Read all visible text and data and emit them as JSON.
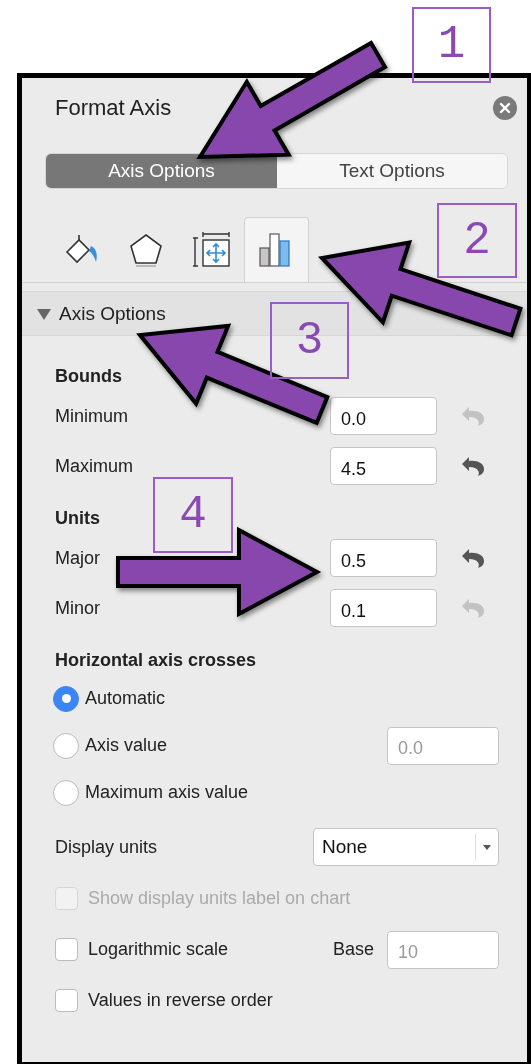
{
  "panel": {
    "title": "Format Axis"
  },
  "option_tabs": [
    {
      "label": "Axis Options",
      "selected": true
    },
    {
      "label": "Text Options",
      "selected": false
    }
  ],
  "icon_tabs": [
    {
      "kind": "fill",
      "selected": false
    },
    {
      "kind": "effects",
      "selected": false
    },
    {
      "kind": "size",
      "selected": false
    },
    {
      "kind": "axis",
      "selected": true
    }
  ],
  "section": {
    "title": "Axis Options",
    "expanded": true
  },
  "fields": [
    {
      "kind": "heading",
      "label": "Bounds"
    },
    {
      "kind": "number",
      "label": "Minimum",
      "value": "0.0",
      "reset_enabled": false
    },
    {
      "kind": "number",
      "label": "Maximum",
      "value": "4.5",
      "reset_enabled": true
    },
    {
      "kind": "heading",
      "label": "Units"
    },
    {
      "kind": "number",
      "label": "Major",
      "value": "0.5",
      "reset_enabled": true
    },
    {
      "kind": "number",
      "label": "Minor",
      "value": "0.1",
      "reset_enabled": false
    },
    {
      "kind": "heading",
      "label": "Horizontal axis crosses"
    }
  ],
  "crosses": [
    {
      "label": "Automatic",
      "selected": true
    },
    {
      "label": "Axis value",
      "selected": false,
      "placeholder": "0.0"
    },
    {
      "label": "Maximum axis value",
      "selected": false
    }
  ],
  "display_units": {
    "label": "Display units",
    "value": "None"
  },
  "checkboxes": [
    {
      "label": "Show display units label on chart",
      "checked": false,
      "disabled": true
    },
    {
      "label": "Logarithmic scale",
      "checked": false,
      "disabled": false,
      "base_label": "Base",
      "base_placeholder": "10"
    },
    {
      "label": "Values in reverse order",
      "checked": false,
      "disabled": false
    }
  ],
  "annotations": [
    {
      "label": "1"
    },
    {
      "label": "2"
    },
    {
      "label": "3"
    },
    {
      "label": "4"
    }
  ]
}
